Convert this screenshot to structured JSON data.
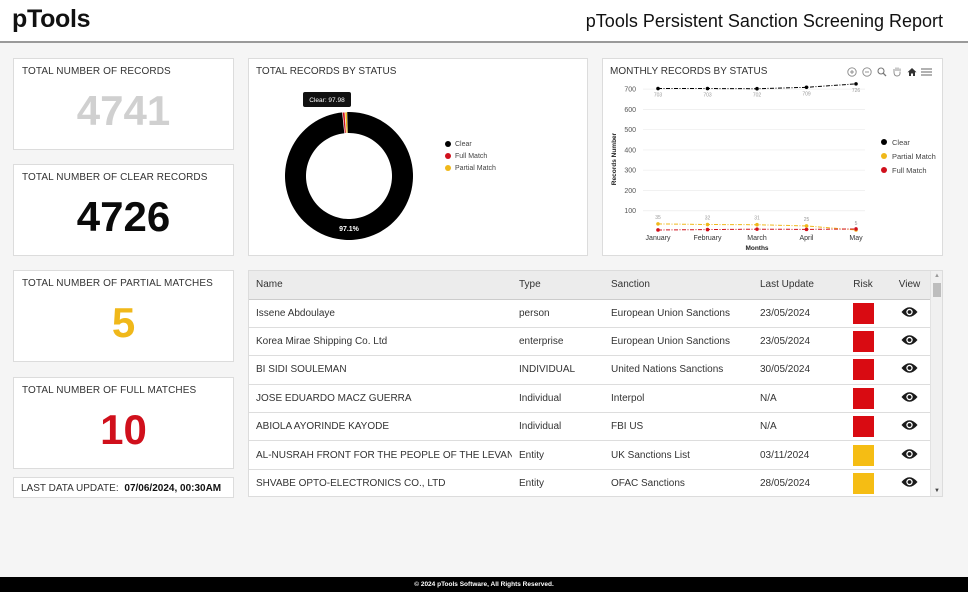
{
  "header": {
    "logo": "pTools",
    "title": "pTools Persistent Sanction Screening Report"
  },
  "kpis": {
    "total_records": {
      "label": "TOTAL NUMBER OF RECORDS",
      "value": "4741",
      "color": "#d0d0d0"
    },
    "clear_records": {
      "label": "TOTAL NUMBER OF CLEAR RECORDS",
      "value": "4726",
      "color": "#0a0a0a"
    },
    "partial_matches": {
      "label": "TOTAL NUMBER OF PARTIAL MATCHES",
      "value": "5",
      "color": "#f0b81a"
    },
    "full_matches": {
      "label": "TOTAL NUMBER OF FULL MATCHES",
      "value": "10",
      "color": "#d0101c"
    }
  },
  "last_update": {
    "label": "LAST DATA UPDATE:",
    "value": "07/06/2024, 00:30AM"
  },
  "chart_data": [
    {
      "type": "pie",
      "title": "TOTAL RECORDS BY STATUS",
      "labels": [
        "Clear",
        "Full Match",
        "Partial Match"
      ],
      "values": [
        4726,
        10,
        5
      ],
      "colors": [
        "#000000",
        "#d0101c",
        "#f0b81a"
      ],
      "slice_label": "97.1%",
      "tooltip": "Clear:  97.98",
      "legend": "right",
      "donut": true
    },
    {
      "type": "line",
      "title": "MONTHLY RECORDS BY STATUS",
      "categories": [
        "January",
        "February",
        "March",
        "April",
        "May"
      ],
      "series": [
        {
          "name": "Clear",
          "color": "#000000",
          "values": [
            703,
            703,
            702,
            709,
            726
          ],
          "labels": [
            "703",
            "703",
            "702",
            "709",
            "726"
          ]
        },
        {
          "name": "Partial Match",
          "color": "#f0b81a",
          "values": [
            35,
            32,
            31,
            25,
            5
          ],
          "labels": [
            "35",
            "32",
            "31",
            "25",
            "5"
          ]
        },
        {
          "name": "Full Match",
          "color": "#d0101c",
          "values": [
            5,
            7,
            9,
            8,
            10
          ],
          "labels": []
        }
      ],
      "xlabel": "Months",
      "ylabel": "Records Number",
      "yticks": [
        "100",
        "200",
        "300",
        "400",
        "500",
        "600",
        "700"
      ],
      "ylim": [
        0,
        750
      ],
      "grid": true,
      "legend": "right",
      "toolbar": [
        "zoom-in-icon",
        "zoom-out-icon",
        "magnify-icon",
        "pan-hand-icon",
        "home-icon",
        "menu-icon"
      ]
    }
  ],
  "table": {
    "columns": [
      "Name",
      "Type",
      "Sanction",
      "Last Update",
      "Risk",
      "View"
    ],
    "rows": [
      {
        "name": "Issene Abdoulaye",
        "type": "person",
        "sanction": "European Union Sanctions",
        "last_update": "23/05/2024",
        "risk": "high",
        "risk_color": "#d90b12"
      },
      {
        "name": "Korea Mirae Shipping Co. Ltd",
        "type": "enterprise",
        "sanction": "European Union Sanctions",
        "last_update": "23/05/2024",
        "risk": "high",
        "risk_color": "#d90b12"
      },
      {
        "name": "BI SIDI SOULEMAN",
        "type": "INDIVIDUAL",
        "sanction": "United Nations Sanctions",
        "last_update": "30/05/2024",
        "risk": "high",
        "risk_color": "#d90b12"
      },
      {
        "name": "JOSE EDUARDO MACZ GUERRA",
        "type": "Individual",
        "sanction": "Interpol",
        "last_update": "N/A",
        "risk": "high",
        "risk_color": "#d90b12"
      },
      {
        "name": "ABIOLA AYORINDE KAYODE",
        "type": "Individual",
        "sanction": "FBI US",
        "last_update": "N/A",
        "risk": "high",
        "risk_color": "#d90b12"
      },
      {
        "name": "AL-NUSRAH FRONT FOR THE PEOPLE OF THE LEVANT",
        "type": "Entity",
        "sanction": "UK Sanctions List",
        "last_update": "03/11/2024",
        "risk": "medium",
        "risk_color": "#f5bd14"
      },
      {
        "name": "SHVABE OPTO-ELECTRONICS CO., LTD",
        "type": "Entity",
        "sanction": "OFAC Sanctions",
        "last_update": "28/05/2024",
        "risk": "medium",
        "risk_color": "#f5bd14"
      }
    ]
  },
  "footer": {
    "text": "© 2024 pTools Software, All Rights Reserved."
  }
}
